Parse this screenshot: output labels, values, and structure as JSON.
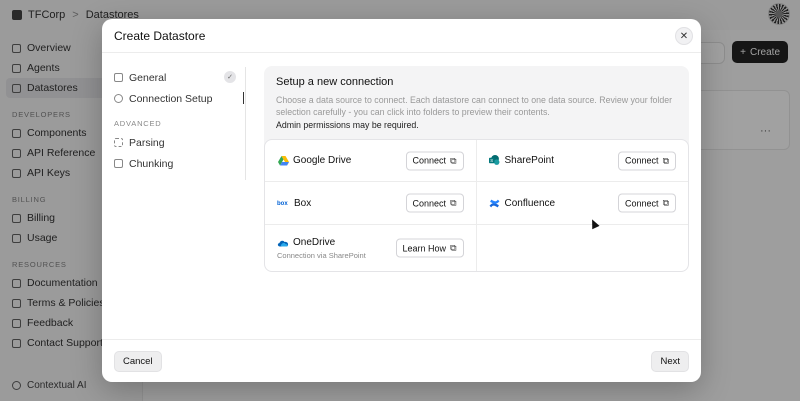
{
  "app": {
    "breadcrumb": [
      "TFCorp",
      "Datastores"
    ],
    "breadcrumb_sep": ">",
    "sidebar": {
      "top_items": [
        "Overview",
        "Agents",
        "Datastores"
      ],
      "developers_label": "DEVELOPERS",
      "developer_items": [
        "Components",
        "API Reference",
        "API Keys"
      ],
      "billing_label": "BILLING",
      "billing_items": [
        "Billing",
        "Usage"
      ],
      "resources_label": "RESOURCES",
      "resource_items": [
        "Documentation",
        "Terms & Policies",
        "Feedback",
        "Contact Support"
      ],
      "footer": "Contextual AI"
    },
    "create_label": "Create",
    "row_menu": "···"
  },
  "modal": {
    "title": "Create Datastore",
    "close_glyph": "✕",
    "steps": {
      "general": "General",
      "connection_setup": "Connection Setup",
      "advanced_label": "ADVANCED",
      "parsing": "Parsing",
      "chunking": "Chunking"
    },
    "intro": {
      "heading": "Setup a new connection",
      "body": "Choose a data source to connect. Each datastore can connect to one data source. Review your folder selection carefully - you can click into folders to preview their contents.",
      "note": "Admin permissions may be required."
    },
    "providers": [
      {
        "name": "Google Drive",
        "button": "Connect",
        "color": "#34a853"
      },
      {
        "name": "SharePoint",
        "button": "Connect",
        "color": "#038387"
      },
      {
        "name": "Box",
        "button": "Connect",
        "color": "#0061d5"
      },
      {
        "name": "Confluence",
        "button": "Connect",
        "color": "#1868db"
      },
      {
        "name": "OneDrive",
        "subtitle": "Connection via SharePoint",
        "button": "Learn How",
        "color": "#0364b8"
      }
    ],
    "external_glyph": "⧉",
    "footer": {
      "cancel": "Cancel",
      "next": "Next"
    }
  }
}
